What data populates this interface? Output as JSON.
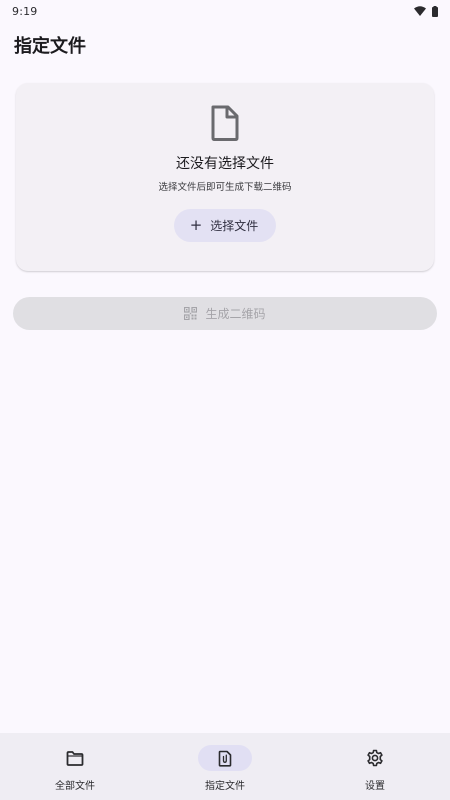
{
  "status_bar": {
    "time": "9:19",
    "icons": [
      "wifi-icon",
      "battery-icon"
    ]
  },
  "app_bar": {
    "title": "指定文件"
  },
  "empty_state": {
    "icon": "file-icon",
    "title": "还没有选择文件",
    "subtitle": "选择文件后即可生成下载二维码",
    "select_button": {
      "icon": "plus-icon",
      "plus_glyph": "+",
      "label": "选择文件"
    }
  },
  "generate_button": {
    "icon": "qr-code-icon",
    "label": "生成二维码",
    "enabled": false
  },
  "bottom_nav": {
    "active_index": 1,
    "items": [
      {
        "label": "全部文件",
        "icon": "folder-icon"
      },
      {
        "label": "指定文件",
        "icon": "attached-file-icon"
      },
      {
        "label": "设置",
        "icon": "gear-icon"
      }
    ]
  },
  "colors": {
    "background": "#fbf8fe",
    "card": "#f3f0f5",
    "tonal_button": "#e3e1f3",
    "disabled_button": "#e0dfe3",
    "nav_bar": "#efedf3",
    "nav_indicator": "#e1dff3"
  }
}
